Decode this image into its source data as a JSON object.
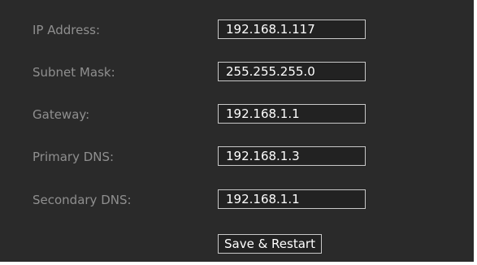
{
  "network_settings": {
    "fields": [
      {
        "label": "IP Address:",
        "value": "192.168.1.117"
      },
      {
        "label": "Subnet Mask:",
        "value": "255.255.255.0"
      },
      {
        "label": "Gateway:",
        "value": "192.168.1.1"
      },
      {
        "label": "Primary DNS:",
        "value": "192.168.1.3"
      },
      {
        "label": "Secondary DNS:",
        "value": "192.168.1.1"
      }
    ],
    "save_label": "Save & Restart"
  },
  "colors": {
    "panel_background": "#2a2a2a",
    "label_text": "#8f8f8f",
    "value_text": "#ffffff",
    "field_border": "#c8c8c8"
  }
}
